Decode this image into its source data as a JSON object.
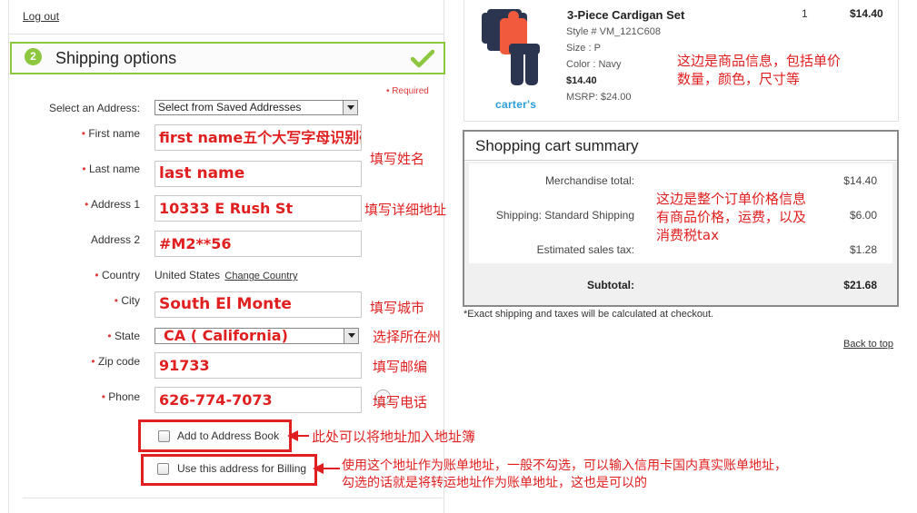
{
  "account": {
    "logout_label": "Log out"
  },
  "shipping": {
    "step_number": "2",
    "title": "Shipping options",
    "required_label": "• Required",
    "select_address_label": "Select an Address:",
    "select_address_value": "Select from Saved Addresses",
    "fields": {
      "first_name": {
        "label": "First name",
        "value": "first name五个大写字母识别码"
      },
      "last_name": {
        "label": "Last name",
        "value": "last name"
      },
      "address1": {
        "label": "Address 1",
        "value": "10333 E Rush St"
      },
      "address2": {
        "label": "Address 2",
        "value": "#M2**56"
      },
      "country": {
        "label": "Country",
        "value": "United States",
        "change_link": "Change Country"
      },
      "city": {
        "label": "City",
        "value": "South El Monte"
      },
      "state": {
        "label": "State",
        "value": "CA ( California)"
      },
      "zip": {
        "label": "Zip code",
        "value": "91733"
      },
      "phone": {
        "label": "Phone",
        "value": "626-774-7073"
      }
    },
    "add_to_address_book_label": "Add to Address Book",
    "use_for_billing_label": "Use this address for Billing"
  },
  "annotations": {
    "last_name": "填写姓名",
    "address": "填写详细地址",
    "city": "填写城市",
    "state": "选择所在州",
    "zip": "填写邮编",
    "phone": "填写电话",
    "address_book": "此处可以将地址加入地址簿",
    "billing_line1": "使用这个地址作为账单地址，一般不勾选，可以输入信用卡国内真实账单地址，",
    "billing_line2": "勾选的话就是将转运地址作为账单地址，这也是可以的",
    "product_line1": "这边是商品信息，包括单价",
    "product_line2": "数量，颜色，尺寸等",
    "summary_line1": "这边是整个订单价格信息",
    "summary_line2": "有商品价格，运费，以及",
    "summary_line3": "消费税tax"
  },
  "product": {
    "brand": "carter's",
    "name": "3-Piece Cardigan Set",
    "style": "Style # VM_121C608",
    "size": "Size : P",
    "color": "Color : Navy",
    "price": "$14.40",
    "msrp": "MSRP: $24.00",
    "quantity": "1",
    "total": "$14.40"
  },
  "summary": {
    "title": "Shopping cart summary",
    "rows": [
      {
        "label": "Merchandise total:",
        "value": "$14.40"
      },
      {
        "label": "Shipping: Standard Shipping",
        "value": "$6.00"
      },
      {
        "label": "Estimated sales tax:",
        "value": "$1.28"
      }
    ],
    "subtotal_label": "Subtotal:",
    "subtotal_value": "$21.68",
    "note": "*Exact shipping and taxes will be calculated at checkout.",
    "back_to_top": "Back to top"
  },
  "colors": {
    "accent_green": "#8dc63f",
    "annotation_red": "#e02020",
    "brand_blue": "#2a9fd6"
  }
}
